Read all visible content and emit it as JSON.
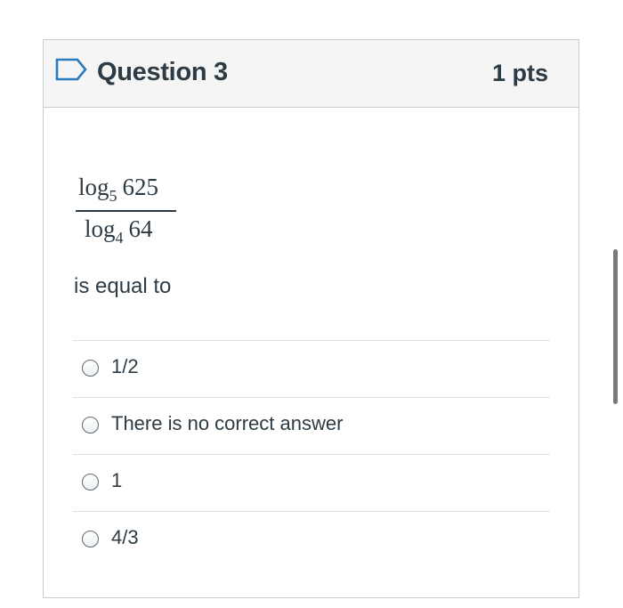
{
  "question": {
    "title": "Question 3",
    "points": "1 pts",
    "expression": {
      "numerator_base": "log",
      "numerator_sub": "5",
      "numerator_arg": "625",
      "denominator_base": "log",
      "denominator_sub": "4",
      "denominator_arg": "64"
    },
    "prompt": "is equal to",
    "answers": [
      {
        "label": "1/2",
        "selected": false
      },
      {
        "label": "There is no correct answer",
        "selected": false
      },
      {
        "label": "1",
        "selected": false
      },
      {
        "label": "4/3",
        "selected": false
      }
    ]
  },
  "icons": {
    "flag": "flag-icon",
    "radio": "radio-button"
  },
  "colors": {
    "text": "#2d3b45",
    "header_bg": "#f5f5f5",
    "border": "#c7cdd1",
    "flag": "#2b7abc"
  }
}
